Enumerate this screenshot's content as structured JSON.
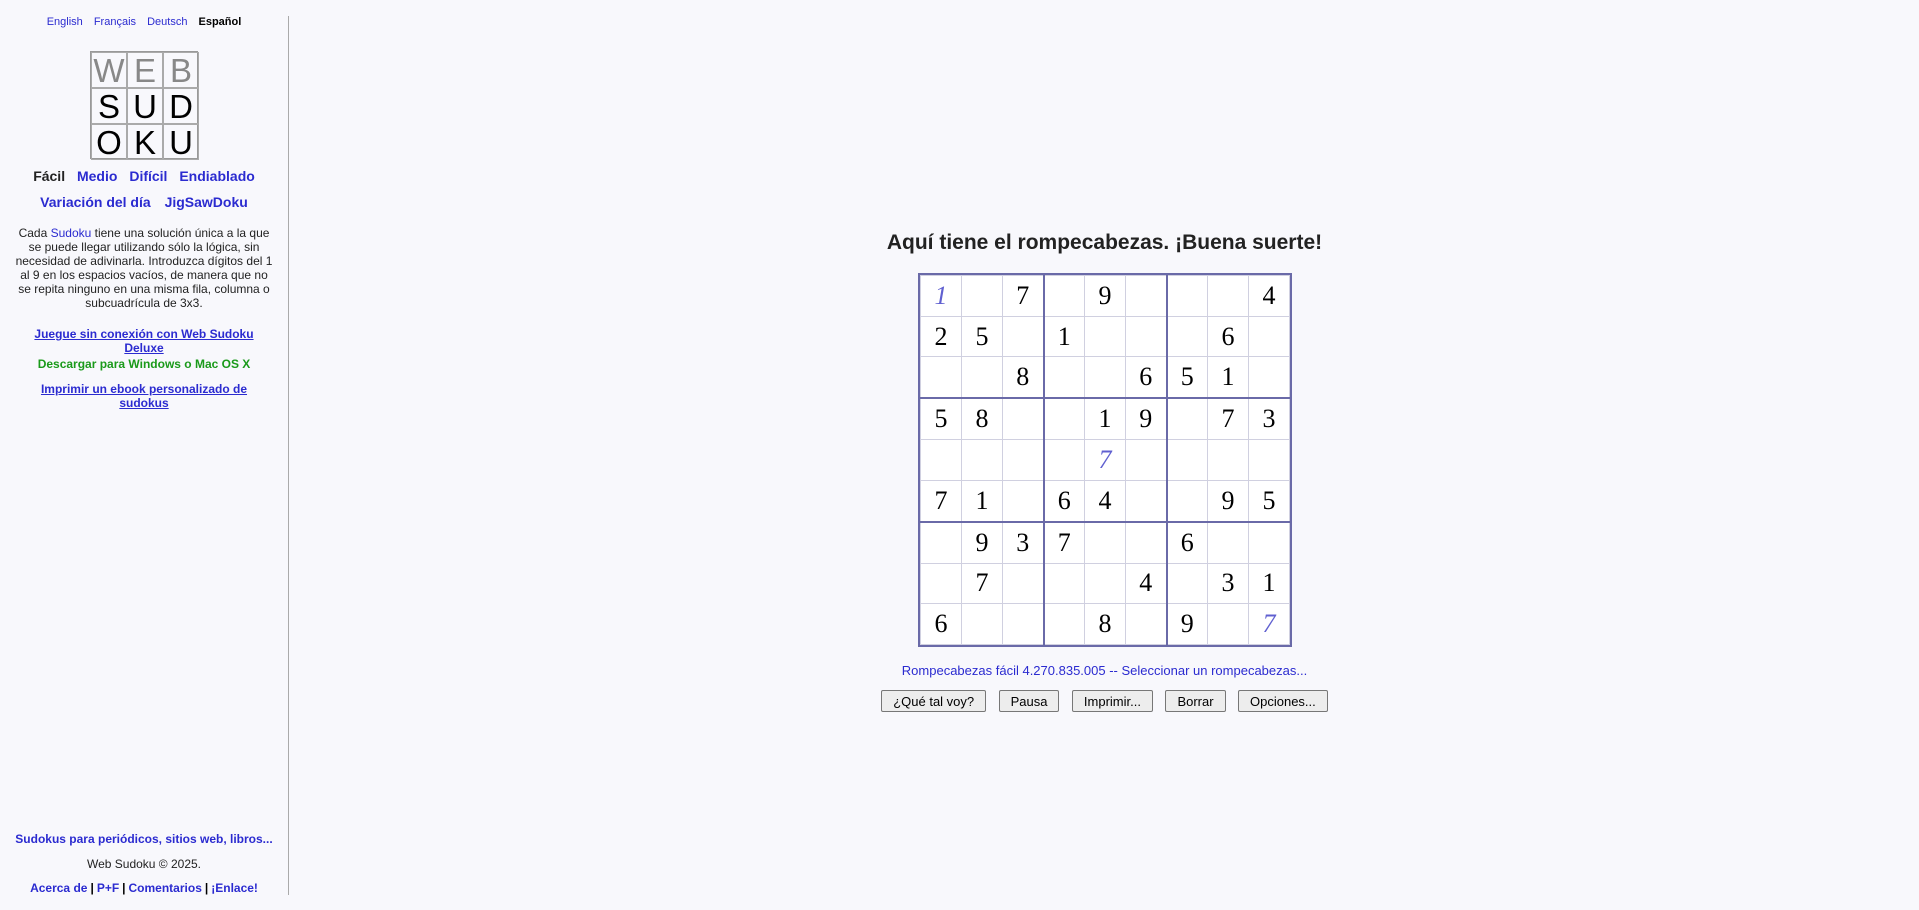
{
  "languages": [
    {
      "label": "English",
      "current": false
    },
    {
      "label": "Français",
      "current": false
    },
    {
      "label": "Deutsch",
      "current": false
    },
    {
      "label": "Español",
      "current": true
    }
  ],
  "logo": {
    "letters": [
      "W",
      "E",
      "B",
      "S",
      "U",
      "D",
      "O",
      "K",
      "U"
    ],
    "gray": [
      true,
      true,
      true,
      false,
      false,
      false,
      false,
      false,
      false
    ]
  },
  "levels": [
    {
      "label": "Fácil",
      "current": true
    },
    {
      "label": "Medio",
      "current": false
    },
    {
      "label": "Difícil",
      "current": false
    },
    {
      "label": "Endiablado",
      "current": false
    }
  ],
  "extras": [
    "Variación del día",
    "JigSawDoku"
  ],
  "description": {
    "prefix": "Cada ",
    "link": "Sudoku",
    "suffix": " tiene una solución única a la que se puede llegar utilizando sólo la lógica, sin necesidad de adivinarla. Introduzca dígitos del 1 al 9 en los espacios vacíos, de manera que no se repita ninguno en una misma fila, columna o subcuadrícula de 3x3."
  },
  "deluxe_link": "Juegue sin conexión con Web Sudoku Deluxe",
  "download_text": "Descargar para Windows o Mac OS X",
  "ebook_link": "Imprimir un ebook personalizado de sudokus",
  "newspapers_link": "Sudokus para periódicos, sitios web, libros...",
  "copyright": "Web Sudoku © 2025.",
  "footer_links": [
    "Acerca de",
    "P+F",
    "Comentarios",
    "¡Enlace!"
  ],
  "headline": "Aquí tiene el rompecabezas. ¡Buena suerte!",
  "grid": [
    [
      "1",
      "",
      "7",
      "",
      "9",
      "",
      "",
      "",
      "4"
    ],
    [
      "2",
      "5",
      "",
      "1",
      "",
      "",
      "",
      "6",
      ""
    ],
    [
      "",
      "",
      "8",
      "",
      "",
      "6",
      "5",
      "1",
      ""
    ],
    [
      "5",
      "8",
      "",
      "",
      "1",
      "9",
      "",
      "7",
      "3"
    ],
    [
      "",
      "",
      "",
      "",
      "7",
      "",
      "",
      "",
      ""
    ],
    [
      "7",
      "1",
      "",
      "6",
      "4",
      "",
      "",
      "9",
      "5"
    ],
    [
      "",
      "9",
      "3",
      "7",
      "",
      "",
      "6",
      "",
      ""
    ],
    [
      "",
      "7",
      "",
      "",
      "",
      "4",
      "",
      "3",
      "1"
    ],
    [
      "6",
      "",
      "",
      "",
      "8",
      "",
      "9",
      "",
      "7"
    ]
  ],
  "user_entries": [
    [
      0,
      0
    ],
    [
      4,
      4
    ],
    [
      8,
      8
    ]
  ],
  "puzzle_info": "Rompecabezas fácil 4.270.835.005 -- Seleccionar un rompecabezas...",
  "buttons": {
    "how_am_i": "¿Qué tal voy?",
    "pause": "Pausa",
    "print": "Imprimir...",
    "clear": "Borrar",
    "options": "Opciones..."
  }
}
